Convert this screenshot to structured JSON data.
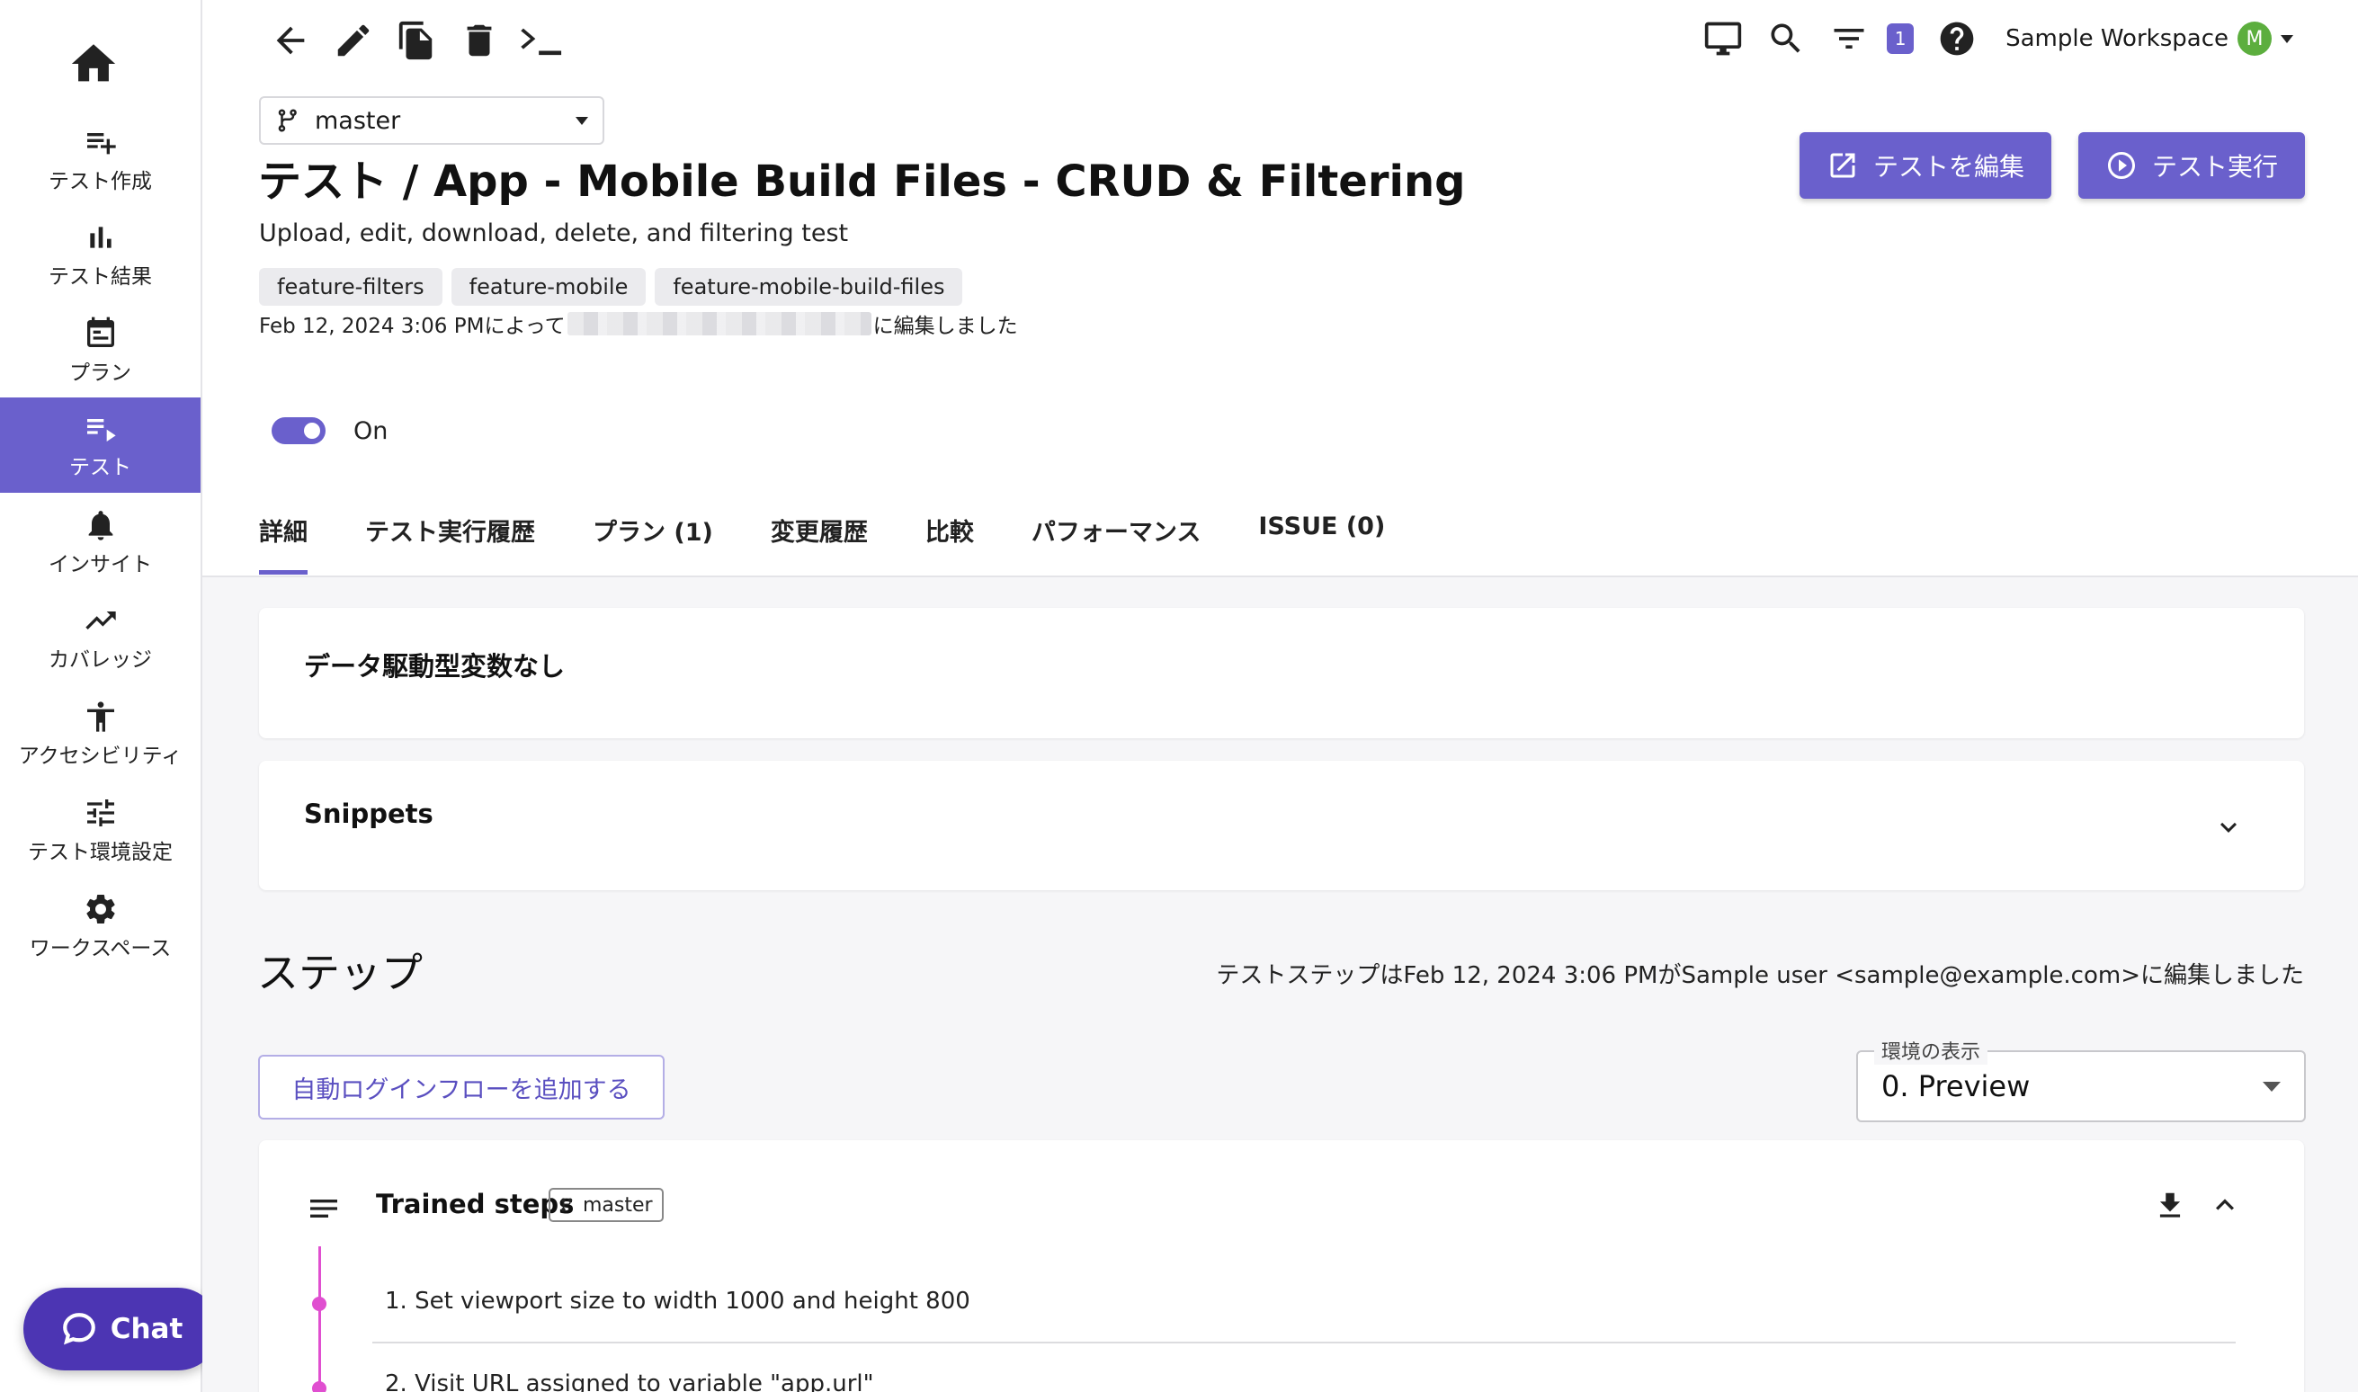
{
  "sidebar": {
    "items": [
      {
        "label": "テスト作成",
        "icon": "playlist-add-icon"
      },
      {
        "label": "テスト結果",
        "icon": "bar-chart-icon"
      },
      {
        "label": "プラン",
        "icon": "calendar-icon"
      },
      {
        "label": "テスト",
        "icon": "playlist-play-icon"
      },
      {
        "label": "インサイト",
        "icon": "bell-icon"
      },
      {
        "label": "カバレッジ",
        "icon": "trending-up-icon"
      },
      {
        "label": "アクセシビリティ",
        "icon": "accessibility-icon"
      },
      {
        "label": "テスト環境設定",
        "icon": "tune-icon"
      },
      {
        "label": "ワークスペース",
        "icon": "gear-icon"
      }
    ],
    "active_index": 3,
    "chat_label": "Chat"
  },
  "topbar": {
    "notification_count": "1",
    "workspace_name": "Sample Workspace",
    "avatar_initial": "M"
  },
  "header": {
    "branch": "master",
    "title": "テスト / App - Mobile Build Files - CRUD & Filtering",
    "description": "Upload, edit, download, delete, and filtering test",
    "tags": [
      "feature-filters",
      "feature-mobile",
      "feature-mobile-build-files"
    ],
    "edited_prefix": "Feb 12, 2024 3:06 PMによって",
    "edited_suffix": "に編集しました",
    "edit_button": "テストを編集",
    "run_button": "テスト実行",
    "toggle_label": "On"
  },
  "tabs": [
    {
      "label": "詳細",
      "active": true
    },
    {
      "label": "テスト実行履歴"
    },
    {
      "label": "プラン (1)"
    },
    {
      "label": "変更履歴"
    },
    {
      "label": "比較"
    },
    {
      "label": "パフォーマンス"
    },
    {
      "label": "ISSUE (0)"
    }
  ],
  "cards": {
    "data_driven": "データ駆動型変数なし",
    "snippets": "Snippets"
  },
  "steps": {
    "heading": "ステップ",
    "meta": "テストステップはFeb 12, 2024 3:06 PMがSample user <sample@example.com>に編集しました",
    "add_login_button": "自動ログインフローを追加する",
    "env_legend": "環境の表示",
    "env_value": "0. Preview",
    "trained_title": "Trained steps",
    "trained_branch": "master",
    "list": [
      "1. Set viewport size to width 1000 and height 800",
      "2. Visit URL assigned to variable \"app.url\""
    ]
  },
  "colors": {
    "accent": "#6a60cc",
    "chat": "#4c35b3",
    "step_line": "#e04fd0",
    "avatar": "#5cae3e"
  }
}
